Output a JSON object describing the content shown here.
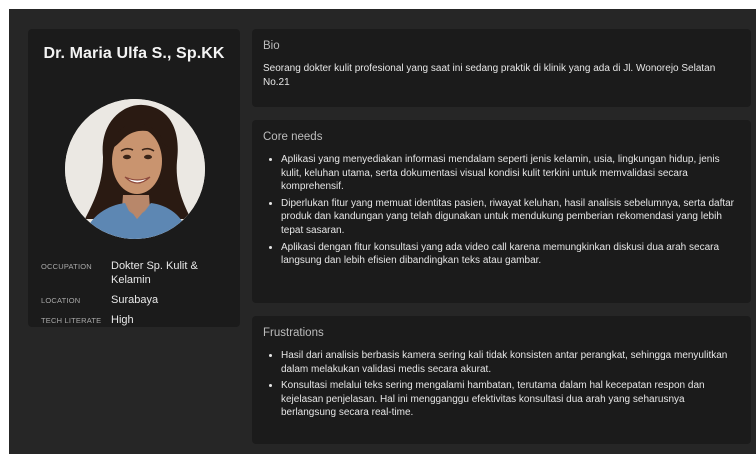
{
  "profile": {
    "name": "Dr. Maria Ulfa S., Sp.KK",
    "details": [
      {
        "key": "OCCUPATION",
        "value": "Dokter Sp. Kulit & Kelamin"
      },
      {
        "key": "LOCATION",
        "value": "Surabaya"
      },
      {
        "key": "TECH LITERATE",
        "value": "High"
      }
    ]
  },
  "bio": {
    "title": "Bio",
    "text": "Seorang dokter kulit profesional yang saat ini sedang praktik di klinik yang ada di Jl. Wonorejo Selatan No.21"
  },
  "core_needs": {
    "title": "Core needs",
    "items": [
      "Aplikasi yang menyediakan  informasi mendalam seperti jenis kelamin, usia, lingkungan hidup, jenis kulit, keluhan utama, serta dokumentasi visual kondisi kulit terkini untuk memvalidasi secara komprehensif.",
      "Diperlukan fitur yang memuat identitas pasien, riwayat keluhan, hasil analisis sebelumnya, serta daftar produk dan kandungan yang telah digunakan untuk mendukung pemberian rekomendasi yang lebih tepat sasaran.",
      "Aplikasi dengan fitur konsultasi yang  ada video call  karena memungkinkan diskusi dua arah secara langsung dan lebih efisien dibandingkan teks atau gambar."
    ]
  },
  "frustrations": {
    "title": "Frustrations",
    "items": [
      "Hasil dari analisis berbasis kamera sering kali tidak konsisten antar perangkat, sehingga menyulitkan dalam melakukan validasi medis secara akurat.",
      "Konsultasi melalui teks sering mengalami hambatan, terutama dalam hal kecepatan respon dan kejelasan penjelasan. Hal ini mengganggu efektivitas konsultasi dua arah yang seharusnya berlangsung secara real-time."
    ]
  }
}
